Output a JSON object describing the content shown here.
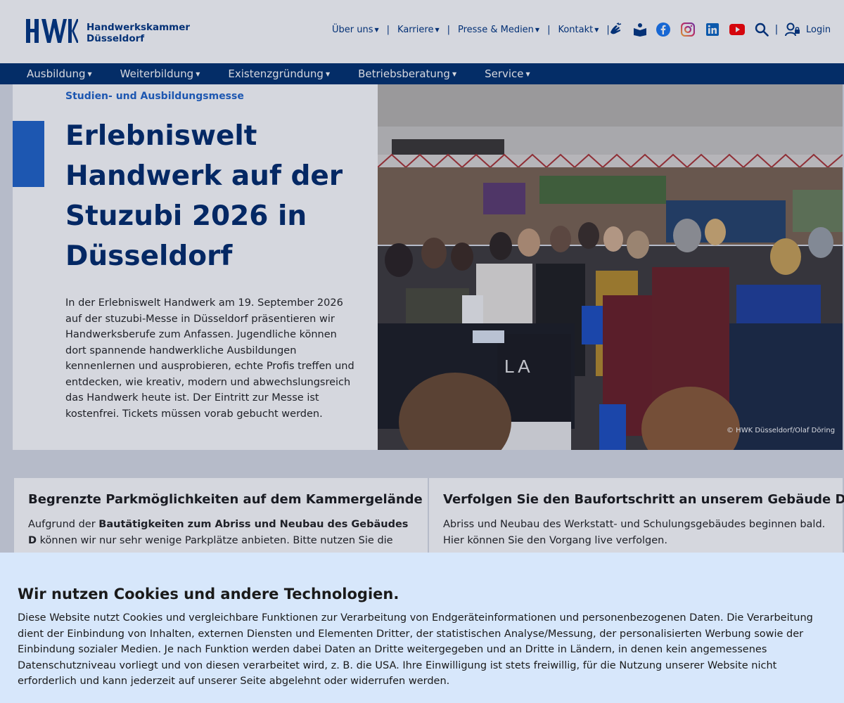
{
  "header": {
    "logo_line1": "Handwerkskammer",
    "logo_line2": "Düsseldorf",
    "top_nav": [
      {
        "label": "Über uns"
      },
      {
        "label": "Karriere"
      },
      {
        "label": "Presse & Medien"
      },
      {
        "label": "Kontakt"
      }
    ],
    "icons": [
      "sign-language-icon",
      "easy-language-icon",
      "facebook-icon",
      "instagram-icon",
      "linkedin-icon",
      "youtube-icon",
      "search-icon",
      "user-icon"
    ],
    "login_label": "Login"
  },
  "main_nav": [
    {
      "label": "Ausbildung"
    },
    {
      "label": "Weiterbildung"
    },
    {
      "label": "Existenzgründung"
    },
    {
      "label": "Betriebsberatung"
    },
    {
      "label": "Service"
    }
  ],
  "hero": {
    "kicker": "Studien- und Ausbildungsmesse",
    "title": "Erlebniswelt Handwerk auf der Stuzubi 2026 in Düsseldorf",
    "text": "In der Erlebniswelt Handwerk am 19. September 2026 auf der stuzubi-Messe in Düsseldorf präsentieren wir Handwerksberufe zum Anfassen. Jugendliche können dort spannende handwerkliche Ausbildungen kennenlernen und ausprobieren, echte Profis treffen und entdecken, wie kreativ, modern und abwechslungsreich das Handwerk heute ist. Der Eintritt zur Messe ist kostenfrei. Tickets müssen vorab gebucht werden.",
    "photo_credit": "© HWK Düsseldorf/Olaf Döring"
  },
  "cards": [
    {
      "title": "Begrenzte Parkmöglichkeiten auf dem Kammergelände",
      "text_before": "Aufgrund der ",
      "text_bold": "Bautätigkeiten zum Abriss und Neubau des Gebäudes D",
      "text_after": " können wir nur sehr wenige Parkplätze anbieten. Bitte nutzen Sie die"
    },
    {
      "title": "Verfolgen Sie den Baufortschritt an unserem Gebäude D!",
      "text": "Abriss und Neubau des Werkstatt- und Schulungsgebäudes beginnen bald. Hier können Sie den Vorgang live verfolgen."
    }
  ],
  "cookie": {
    "title": "Wir nutzen Cookies und andere Technologien.",
    "text": "Diese Website nutzt Cookies und vergleichbare Funktionen zur Verarbeitung von Endgeräteinformationen und personenbezogenen Daten. Die Verarbeitung dient der Einbindung von Inhalten, externen Diensten und Elementen Dritter, der statistischen Analyse/Messung, der personalisierten Werbung sowie der Einbindung sozialer Medien. Je nach Funktion werden dabei Daten an Dritte weitergegeben und an Dritte in Ländern, in denen kein angemessenes Datenschutzniveau vorliegt und von diesen verarbeitet wird, z. B. die USA. Ihre Einwilligung ist stets freiwillig, für die Nutzung unserer Website nicht erforderlich und kann jederzeit auf unserer Seite abgelehnt oder widerrufen werden."
  },
  "colors": {
    "brand_blue": "#003580",
    "nav_bg": "#00306e",
    "accent": "#1f63c8",
    "cookie_bg": "#d7e7fb"
  }
}
